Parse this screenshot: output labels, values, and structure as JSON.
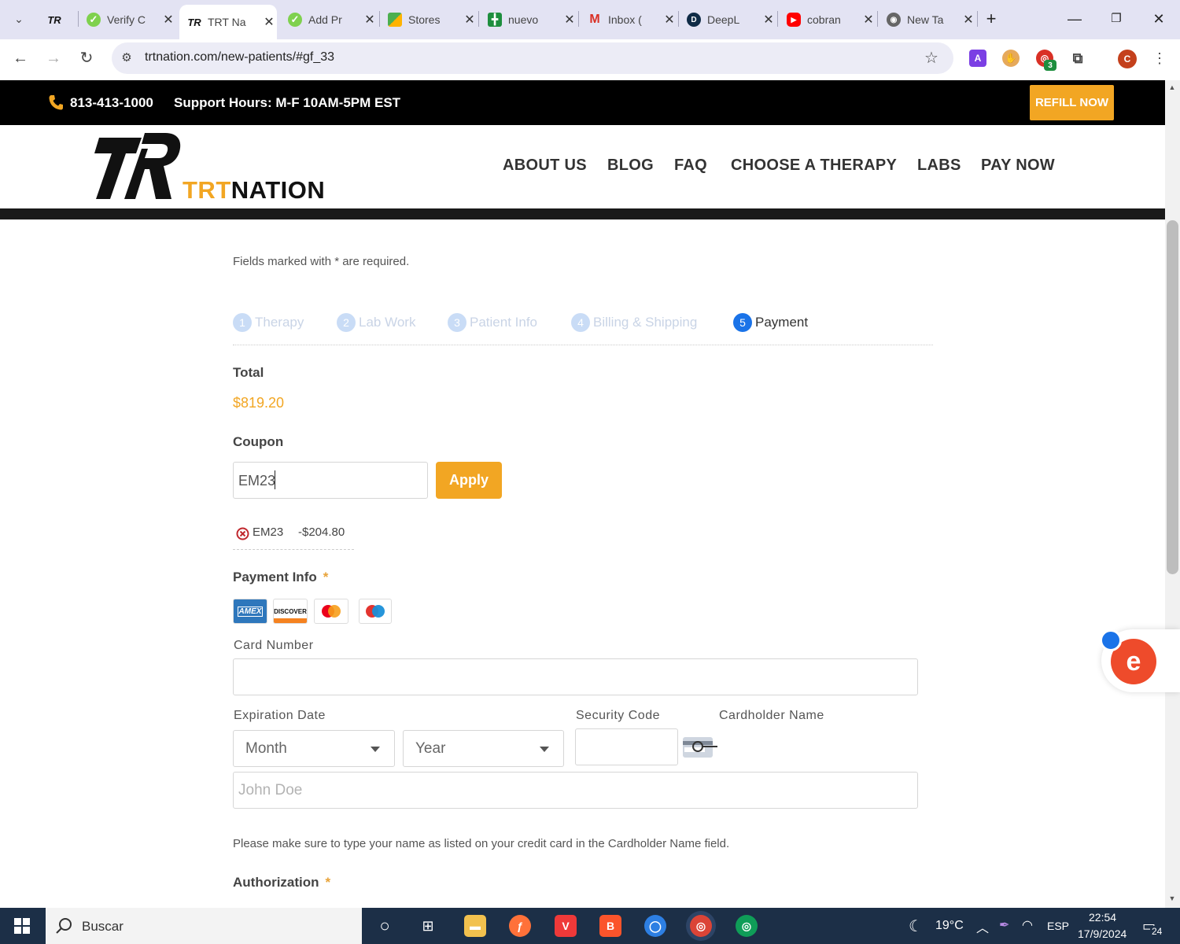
{
  "browser": {
    "tabs": [
      {
        "label": "",
        "icon": "trt-logo-icon"
      },
      {
        "label": "Verify C",
        "icon": "check-icon"
      },
      {
        "label": "TRT Na",
        "icon": "trt-logo-icon",
        "active": true
      },
      {
        "label": "Add Pr",
        "icon": "check-icon"
      },
      {
        "label": "Stores",
        "icon": "stores-icon"
      },
      {
        "label": "nuevo",
        "icon": "sheets-icon"
      },
      {
        "label": "Inbox (",
        "icon": "gmail-icon"
      },
      {
        "label": "DeepL",
        "icon": "deepl-icon"
      },
      {
        "label": "cobran",
        "icon": "youtube-icon"
      },
      {
        "label": "New Ta",
        "icon": "chrome-icon"
      }
    ],
    "url": "trtnation.com/new-patients/#gf_33",
    "extension_badge": "3",
    "profile_initial": "C"
  },
  "site": {
    "phone": "813-413-1000",
    "hours": "Support Hours: M-F 10AM-5PM EST",
    "refill_button": "REFILL NOW",
    "logo_trt": "TRT",
    "logo_nation": "NATION",
    "nav": [
      "ABOUT US",
      "BLOG",
      "FAQ",
      "CHOOSE A THERAPY",
      "LABS",
      "PAY NOW"
    ]
  },
  "form": {
    "required_note": "Fields marked with * are required.",
    "steps": [
      {
        "num": "1",
        "label": "Therapy"
      },
      {
        "num": "2",
        "label": "Lab Work"
      },
      {
        "num": "3",
        "label": "Patient Info"
      },
      {
        "num": "4",
        "label": "Billing & Shipping"
      },
      {
        "num": "5",
        "label": "Payment"
      }
    ],
    "total_label": "Total",
    "total_value": "$819.20",
    "coupon_label": "Coupon",
    "coupon_value": "EM23",
    "apply_button": "Apply",
    "applied_coupon_code": "EM23",
    "applied_coupon_amount": "-$204.80",
    "payment_info_label": "Payment Info",
    "required_star": "*",
    "cards": [
      "AMEX",
      "DISCOVER",
      "Mastercard",
      "Maestro"
    ],
    "card_number_label": "Card Number",
    "expiration_label": "Expiration Date",
    "month_placeholder": "Month",
    "year_placeholder": "Year",
    "security_code_label": "Security Code",
    "cardholder_label": "Cardholder Name",
    "cardholder_placeholder": "John Doe",
    "cardholder_note": "Please make sure to type your name as listed on your credit card in the Cardholder Name field.",
    "authorization_label": "Authorization"
  },
  "taskbar": {
    "search": "Buscar",
    "temperature": "19°C",
    "language": "ESP",
    "time": "22:54",
    "date": "17/9/2024",
    "notifications": "24"
  },
  "colors": {
    "accent": "#f2a623",
    "step_active": "#1a73e8",
    "topbar": "#000000"
  }
}
